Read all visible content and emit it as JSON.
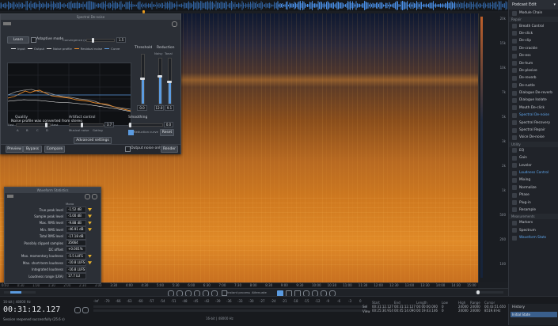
{
  "right_panel": {
    "header": "Podcast Edit",
    "module_chain": "Module Chain",
    "sections": [
      {
        "title": "Repair",
        "items": [
          "Breath Control",
          "De-click",
          "De-clip",
          "De-crackle",
          "De-ess",
          "De-hum",
          "De-plosive",
          "De-reverb",
          "De-rustle",
          "Dialogue De-reverb",
          "Dialogue Isolate",
          "Mouth De-click",
          "Spectral De-noise",
          "Spectral Recovery",
          "Spectral Repair",
          "Voice De-noise"
        ],
        "active": "Spectral De-noise"
      },
      {
        "title": "Utility",
        "items": [
          "EQ",
          "Gain",
          "Leveler",
          "Loudness Control",
          "Mixing",
          "Normalize",
          "Phase",
          "Plug-in",
          "Resample"
        ],
        "active": "Loudness Control"
      },
      {
        "title": "Measurements",
        "items": [
          "Markers",
          "Spectrum",
          "Waveform Stats"
        ],
        "active": "Waveform Stats"
      }
    ]
  },
  "denoise": {
    "title": "Spectral De-noise",
    "learn": "Learn",
    "adaptive": "Adaptive mode",
    "convergence_label": "Convergence (s)",
    "convergence_value": "1.5",
    "legend": [
      "Input",
      "Output",
      "Noise profile",
      "Residual noise",
      "Curve"
    ],
    "legend_colors": [
      "#d8dadd",
      "#f0f0f0",
      "#c9c9c9",
      "#e88a2a",
      "#5b9be0"
    ],
    "caption": "Noise profile was converted from stereo",
    "threshold_label": "Threshold",
    "threshold_value": "0.0",
    "reduction_label": "Reduction",
    "noisy_label": "Noisy",
    "tonal_label": "Tonal",
    "noisy_value": "12.0",
    "tonal_value": "9.1",
    "quality_label": "Quality",
    "quality_fast": "Fast",
    "quality_best": "Best",
    "quality_letters": [
      "A",
      "B",
      "C",
      "D"
    ],
    "artifact_label": "Artifact control",
    "artifact_value": "3.7",
    "musical_noise": "Musical noise",
    "gating": "Gating",
    "smoothing_label": "Smoothing",
    "smoothing_value": "0.0",
    "reduction_curve": "Reduction curve",
    "reset": "Reset",
    "advanced": "Advanced settings",
    "preview": "Preview",
    "bypass": "Bypass",
    "compare": "Compare",
    "output_noise_only": "Output noise only",
    "render": "Render"
  },
  "loudness": {
    "title": "Waveform Statistics",
    "column": "Mono",
    "rows": [
      {
        "name": "True peak level",
        "value": "-1.52 dB",
        "flag": true
      },
      {
        "name": "Sample peak level",
        "value": "-5.00 dB",
        "flag": true
      },
      {
        "name": "Max. RMS level",
        "value": "-9.88 dB",
        "flag": true
      },
      {
        "name": "Min. RMS level",
        "value": "-46.91 dB",
        "flag": true
      },
      {
        "name": "Total RMS level",
        "value": "-17.18 dB",
        "flag": false
      },
      {
        "name": "Possibly clipped samples",
        "value": "35664",
        "flag": false
      },
      {
        "name": "DC offset",
        "value": "+0.001%",
        "flag": false
      },
      {
        "name": "Max. momentary loudness",
        "value": "-5.5 LUFS",
        "flag": true
      },
      {
        "name": "Max. short-term loudness",
        "value": "-10.8 LUFS",
        "flag": true
      },
      {
        "name": "Integrated loudness",
        "value": "-16.8 LUFS",
        "flag": false
      },
      {
        "name": "Loudness range (LRA)",
        "value": "17.7 LU",
        "flag": false
      }
    ]
  },
  "ruler": {
    "freq_ticks": [
      "20k",
      "15k",
      "10k",
      "7k",
      "5k",
      "3k",
      "2k",
      "1k",
      "500",
      "200",
      "100"
    ],
    "time_ticks": [
      "0:00",
      "0:30",
      "1:00",
      "1:30",
      "2:00",
      "2:30",
      "3:00",
      "3:30",
      "4:00",
      "4:30",
      "5:00",
      "5:30",
      "6:00",
      "6:30",
      "7:00",
      "7:30",
      "8:00",
      "8:30",
      "9:00",
      "9:30",
      "10:00",
      "10:30",
      "11:00",
      "11:30",
      "12:00",
      "12:30",
      "13:00",
      "13:30",
      "14:00",
      "14:30",
      "15:00"
    ]
  },
  "toolbar": {
    "instant_process": "Instant process",
    "attenuate": "Attenuate"
  },
  "status": {
    "format": "16-bit | 48000 Hz",
    "timecode": "00:31:12.127",
    "message": "Session reopened successfully (25.6 s)",
    "meter_scale": [
      "-Inf",
      "-70",
      "-66",
      "-63",
      "-60",
      "-57",
      "-54",
      "-51",
      "-48",
      "-45",
      "-42",
      "-39",
      "-36",
      "-33",
      "-30",
      "-27",
      "-24",
      "-21",
      "-18",
      "-15",
      "-12",
      "-9",
      "-6",
      "-3",
      "0"
    ],
    "meter_label": "16-bit | 48000 Hz",
    "sel_headers": [
      "Start",
      "End",
      "Length",
      "Low",
      "High",
      "Range",
      "Cursor"
    ],
    "sel_row1": [
      "00:31:12.127",
      "00:31:12.127",
      "00:00:00.000",
      "0",
      "24000",
      "24000",
      "00:43:51.650"
    ],
    "sel_row2": [
      "00:25:30.914",
      "00:45:14.090",
      "00:19:43.146",
      "0",
      "24000",
      "24000",
      "8519.8 Hz"
    ],
    "sel_row_labels": [
      "Sel",
      "View"
    ],
    "history_title": "History",
    "history_item": "Initial State"
  },
  "colors": {
    "accent": "#5b9be0",
    "warn": "#e8b22c",
    "spectrum": "#e88a2a"
  }
}
